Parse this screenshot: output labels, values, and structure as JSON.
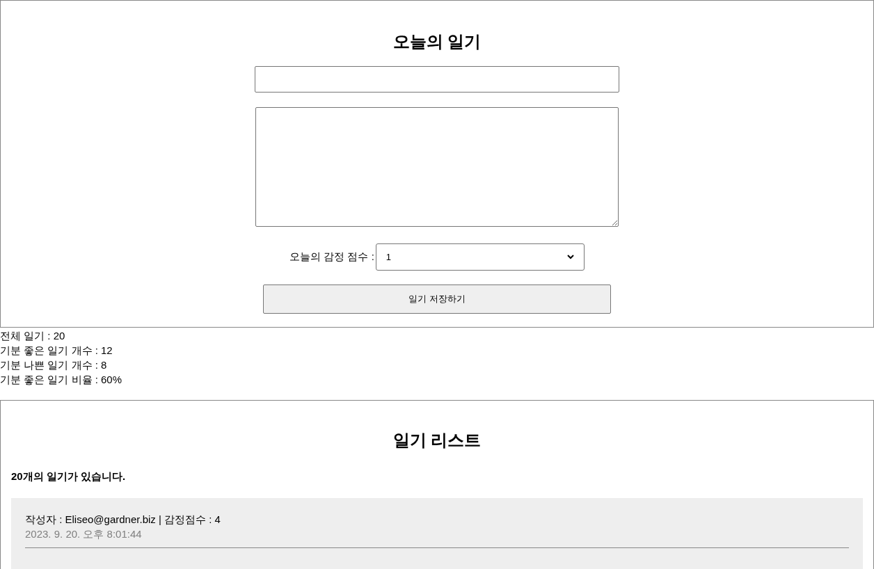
{
  "editor": {
    "title": "오늘의 일기",
    "score_label": "오늘의 감정 점수 :",
    "score_value": "1",
    "save_button": "일기 저장하기"
  },
  "stats": [
    "전체 일기 : 20",
    "기분 좋은 일기 개수 : 12",
    "기분 나쁜 일기 개수 : 8",
    "기분 좋은 일기 비율 : 60%"
  ],
  "list": {
    "title": "일기 리스트",
    "count_text": "20개의 일기가 있습니다.",
    "items": [
      {
        "info": "작성자 : Eliseo@gardner.biz | 감정점수 : 4",
        "date": "2023. 9. 20. 오후 8:01:44"
      }
    ]
  }
}
